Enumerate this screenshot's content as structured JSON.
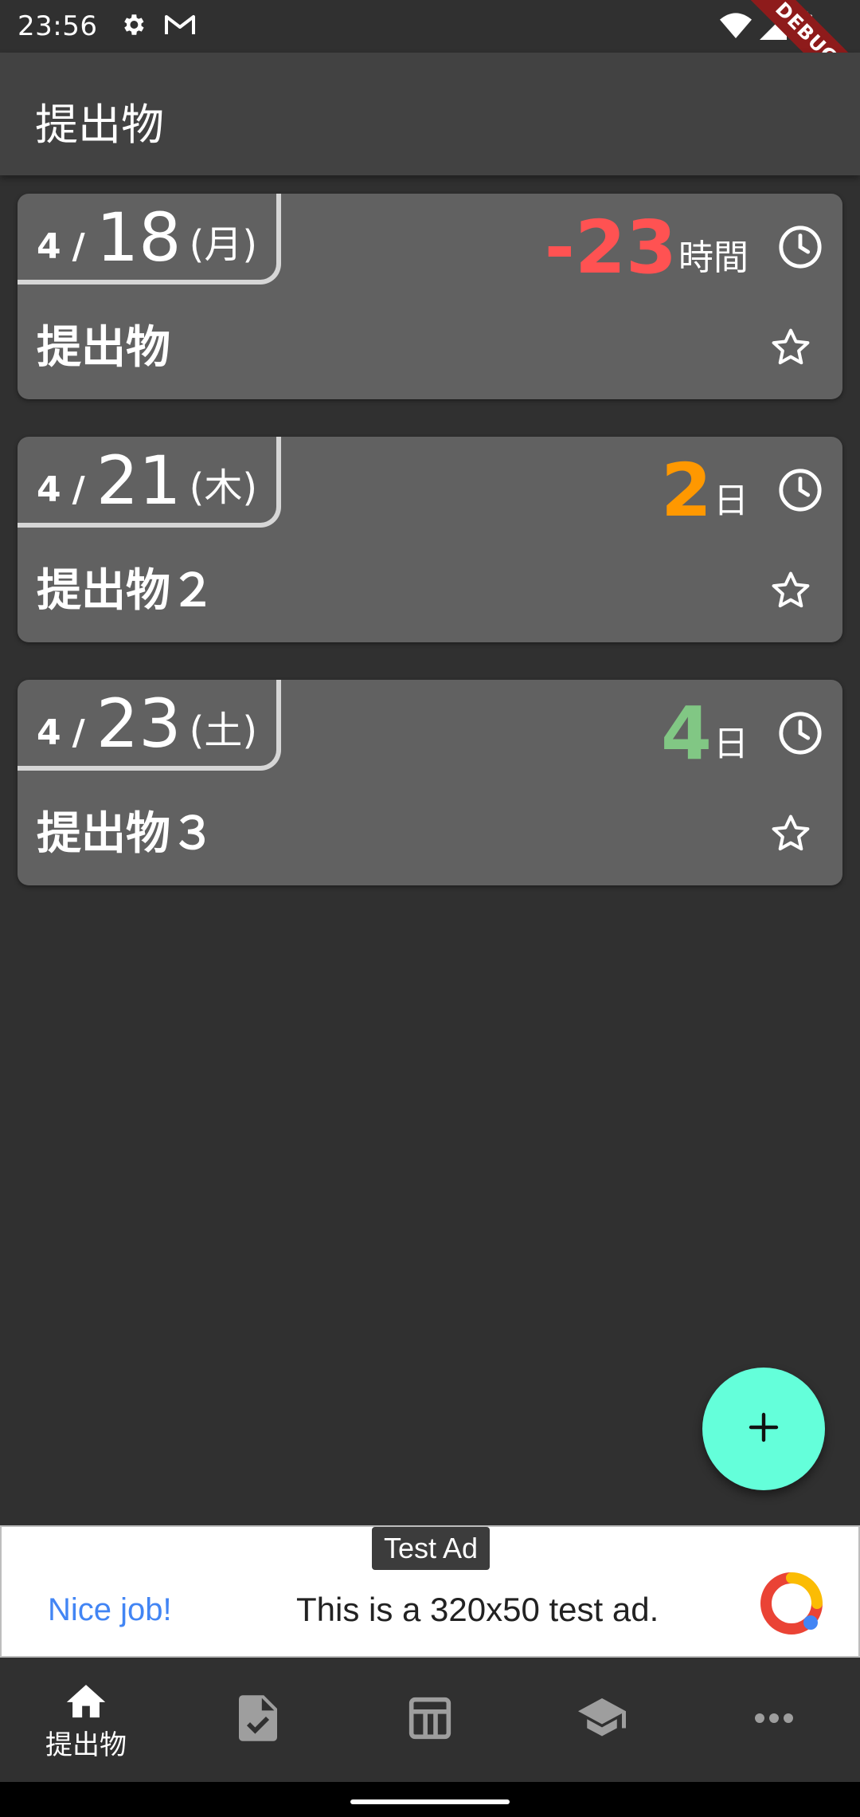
{
  "status_bar": {
    "time": "23:56",
    "debug_label": "DEBUG"
  },
  "app_bar": {
    "title": "提出物"
  },
  "cards": [
    {
      "month": "4",
      "sep": "/",
      "day": "18",
      "dow": "(月)",
      "remaining_value": "-23",
      "remaining_unit": "時間",
      "remaining_color": "#ff5252",
      "title": "提出物"
    },
    {
      "month": "4",
      "sep": "/",
      "day": "21",
      "dow": "(木)",
      "remaining_value": "2",
      "remaining_unit": "日",
      "remaining_color": "#ff9800",
      "title": "提出物２"
    },
    {
      "month": "4",
      "sep": "/",
      "day": "23",
      "dow": "(土)",
      "remaining_value": "4",
      "remaining_unit": "日",
      "remaining_color": "#81c784",
      "title": "提出物３"
    }
  ],
  "fab": {
    "icon": "plus-icon",
    "color": "#64ffda"
  },
  "ad": {
    "label": "Test Ad",
    "nice_text": "Nice job!",
    "body_text": "This is a 320x50 test ad."
  },
  "bottom_nav": {
    "items": [
      {
        "icon": "home-icon",
        "label": "提出物",
        "selected": true
      },
      {
        "icon": "task-document-icon",
        "label": "",
        "selected": false
      },
      {
        "icon": "timetable-icon",
        "label": "",
        "selected": false
      },
      {
        "icon": "school-icon",
        "label": "",
        "selected": false
      },
      {
        "icon": "more-horiz-icon",
        "label": "",
        "selected": false
      }
    ]
  }
}
